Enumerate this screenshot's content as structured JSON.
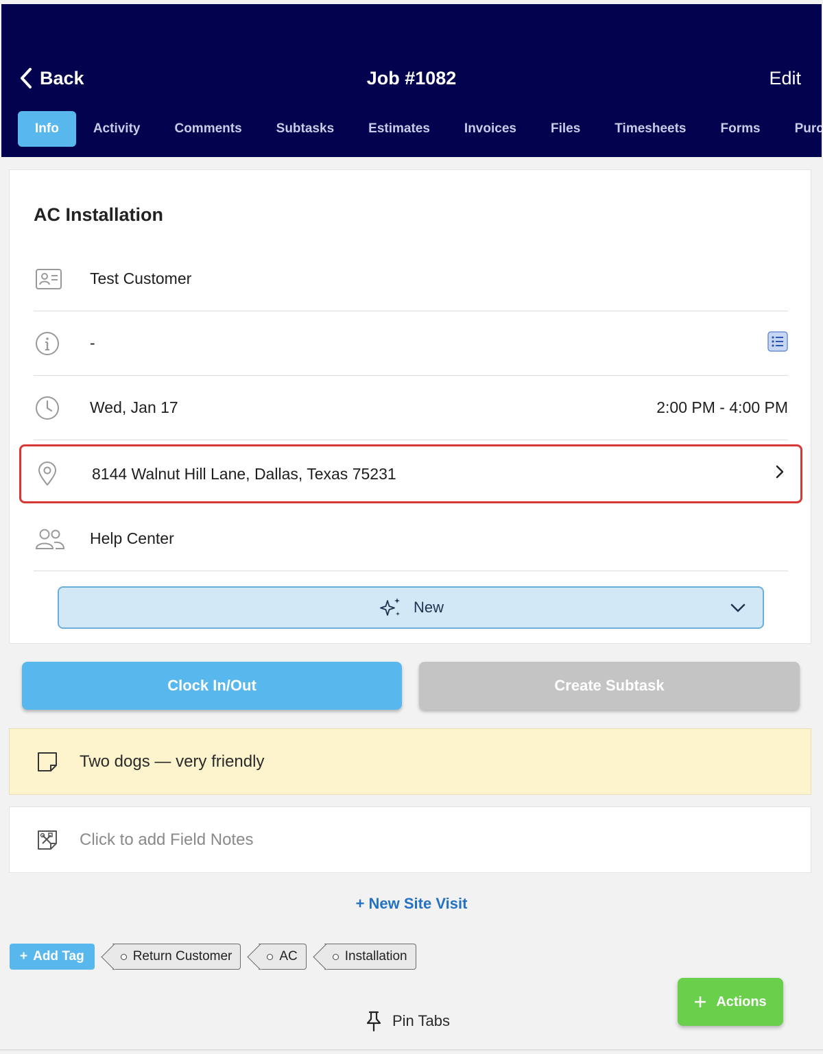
{
  "header": {
    "back_label": "Back",
    "title": "Job #1082",
    "edit_label": "Edit",
    "bg_color": "#02024f"
  },
  "tabs": [
    {
      "label": "Info",
      "active": true
    },
    {
      "label": "Activity"
    },
    {
      "label": "Comments"
    },
    {
      "label": "Subtasks"
    },
    {
      "label": "Estimates"
    },
    {
      "label": "Invoices"
    },
    {
      "label": "Files"
    },
    {
      "label": "Timesheets"
    },
    {
      "label": "Forms"
    },
    {
      "label": "Purch"
    }
  ],
  "job": {
    "title": "AC Installation",
    "customer": "Test Customer",
    "description": "-",
    "date": "Wed, Jan 17",
    "time_range": "2:00 PM - 4:00 PM",
    "address": "8144 Walnut Hill Lane, Dallas, Texas 75231",
    "assignee": "Help Center",
    "status": "New"
  },
  "buttons": {
    "clock": "Clock In/Out",
    "subtask": "Create Subtask",
    "new_site_visit": "+ New Site Visit",
    "add_tag": "Add Tag",
    "actions": "Actions",
    "pin_tabs": "Pin Tabs"
  },
  "note": "Two dogs — very friendly",
  "field_notes_placeholder": "Click to add Field Notes",
  "tags": [
    "Return Customer",
    "AC",
    "Installation"
  ],
  "icons": {
    "back": "chevron-left-icon",
    "customer": "contact-card-icon",
    "info": "info-icon",
    "clock": "clock-icon",
    "location": "map-pin-icon",
    "users": "users-icon",
    "sparkle": "sparkle-icon",
    "note": "sticky-note-icon",
    "field_notes": "tools-note-icon",
    "pin": "pin-icon"
  },
  "colors": {
    "accent_blue": "#58b8ee",
    "highlight_red": "#d93636",
    "actions_green": "#6acf4a",
    "note_yellow": "#fdf3cd"
  }
}
